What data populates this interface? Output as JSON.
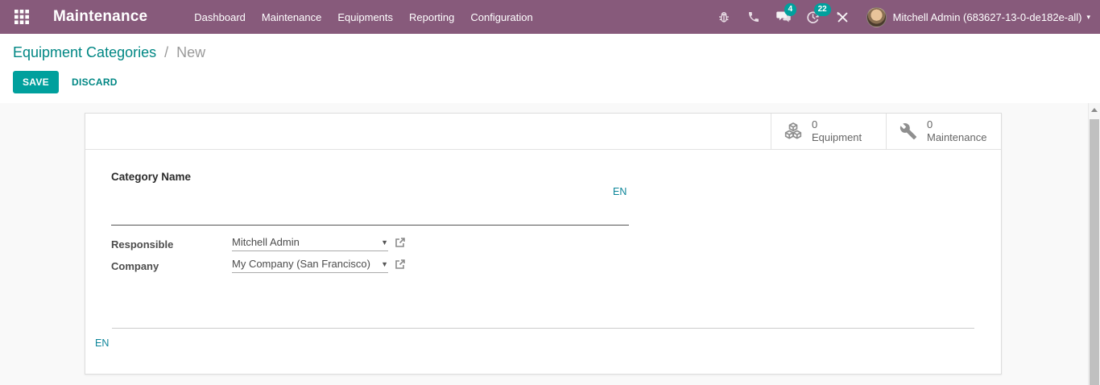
{
  "navbar": {
    "app_title": "Maintenance",
    "menu_items": [
      {
        "label": "Dashboard"
      },
      {
        "label": "Maintenance"
      },
      {
        "label": "Equipments"
      },
      {
        "label": "Reporting"
      },
      {
        "label": "Configuration"
      }
    ],
    "messages_badge": "4",
    "activities_badge": "22",
    "user_name": "Mitchell Admin (683627-13-0-de182e-all)",
    "caret": "▾"
  },
  "breadcrumb": {
    "parent": "Equipment Categories",
    "separator": "/",
    "current": "New"
  },
  "actions": {
    "save_label": "SAVE",
    "discard_label": "DISCARD"
  },
  "stat_buttons": [
    {
      "value": "0",
      "label": "Equipment"
    },
    {
      "value": "0",
      "label": "Maintenance"
    }
  ],
  "form": {
    "category_name_label": "Category Name",
    "category_name_value": "",
    "translation_badge": "EN",
    "fields": [
      {
        "label": "Responsible",
        "value": "Mitchell Admin"
      },
      {
        "label": "Company",
        "value": "My Company (San Francisco)"
      }
    ],
    "footer_translation_badge": "EN",
    "m2o_caret": "▼"
  },
  "colors": {
    "navbar": "#875A7B",
    "accent": "#00A09D",
    "link": "#008784",
    "translation": "#0c8599"
  }
}
